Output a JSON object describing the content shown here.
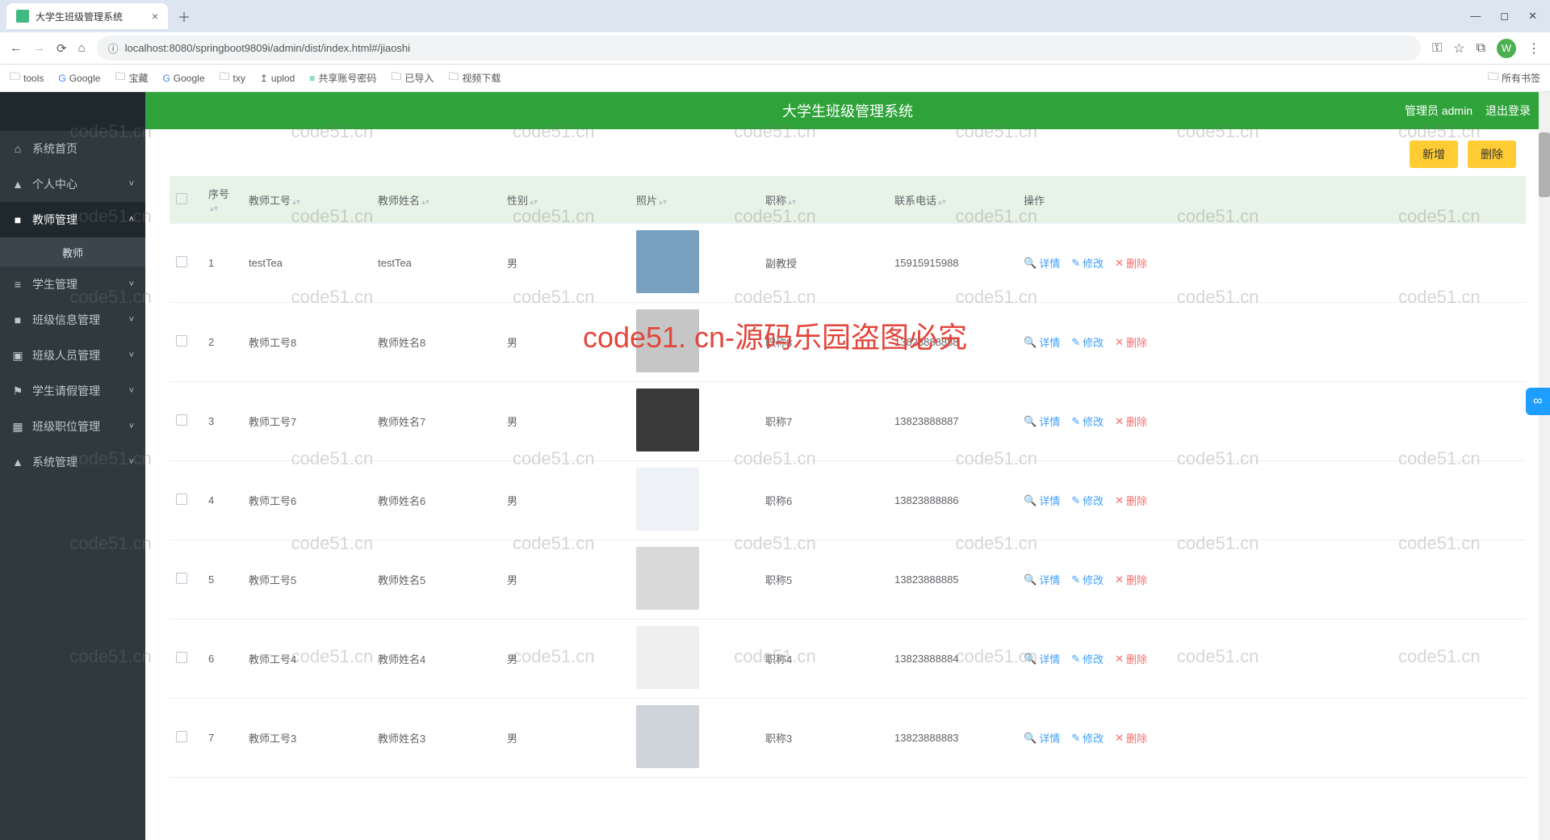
{
  "browser": {
    "tab_title": "大学生班级管理系统",
    "url": "localhost:8080/springboot9809i/admin/dist/index.html#/jiaoshi",
    "bookmarks": [
      "tools",
      "Google",
      "宝藏",
      "Google",
      "txy",
      "uplod",
      "共享账号密码",
      "已导入",
      "视频下载"
    ],
    "bookmark_right": "所有书签"
  },
  "app": {
    "title": "大学生班级管理系统",
    "user_label": "管理员 admin",
    "logout": "退出登录"
  },
  "sidebar": {
    "items": [
      {
        "icon": "⌂",
        "label": "系统首页",
        "caret": ""
      },
      {
        "icon": "▲",
        "label": "个人中心",
        "caret": "˅"
      },
      {
        "icon": "■",
        "label": "教师管理",
        "caret": "˄",
        "active": true,
        "sub": "教师"
      },
      {
        "icon": "≡",
        "label": "学生管理",
        "caret": "˅"
      },
      {
        "icon": "■",
        "label": "班级信息管理",
        "caret": "˅"
      },
      {
        "icon": "▣",
        "label": "班级人员管理",
        "caret": "˅"
      },
      {
        "icon": "⚑",
        "label": "学生请假管理",
        "caret": "˅"
      },
      {
        "icon": "▦",
        "label": "班级职位管理",
        "caret": "˅"
      },
      {
        "icon": "▲",
        "label": "系统管理",
        "caret": "˅"
      }
    ]
  },
  "actions": {
    "add": "新增",
    "delete": "删除"
  },
  "table": {
    "headers": {
      "seq": "序号",
      "id": "教师工号",
      "name": "教师姓名",
      "gender": "性别",
      "photo": "照片",
      "title": "职称",
      "phone": "联系电话",
      "ops": "操作"
    },
    "op_labels": {
      "detail": "详情",
      "edit": "修改",
      "delete": "删除"
    },
    "rows": [
      {
        "seq": "1",
        "id": "testTea",
        "name": "testTea",
        "gender": "男",
        "title": "副教授",
        "phone": "15915915988",
        "photo": "#7aa0bf"
      },
      {
        "seq": "2",
        "id": "教师工号8",
        "name": "教师姓名8",
        "gender": "男",
        "title": "职称8",
        "phone": "13823888888",
        "photo": "#c6c6c6"
      },
      {
        "seq": "3",
        "id": "教师工号7",
        "name": "教师姓名7",
        "gender": "男",
        "title": "职称7",
        "phone": "13823888887",
        "photo": "#3a3a3a"
      },
      {
        "seq": "4",
        "id": "教师工号6",
        "name": "教师姓名6",
        "gender": "男",
        "title": "职称6",
        "phone": "13823888886",
        "photo": "#eef1f5"
      },
      {
        "seq": "5",
        "id": "教师工号5",
        "name": "教师姓名5",
        "gender": "男",
        "title": "职称5",
        "phone": "13823888885",
        "photo": "#d9d9d9"
      },
      {
        "seq": "6",
        "id": "教师工号4",
        "name": "教师姓名4",
        "gender": "男",
        "title": "职称4",
        "phone": "13823888884",
        "photo": "#efefef"
      },
      {
        "seq": "7",
        "id": "教师工号3",
        "name": "教师姓名3",
        "gender": "男",
        "title": "职称3",
        "phone": "13823888883",
        "photo": "#cfd4da"
      }
    ]
  },
  "watermark": {
    "text": "code51.cn",
    "big": "code51. cn-源码乐园盗图必究"
  }
}
